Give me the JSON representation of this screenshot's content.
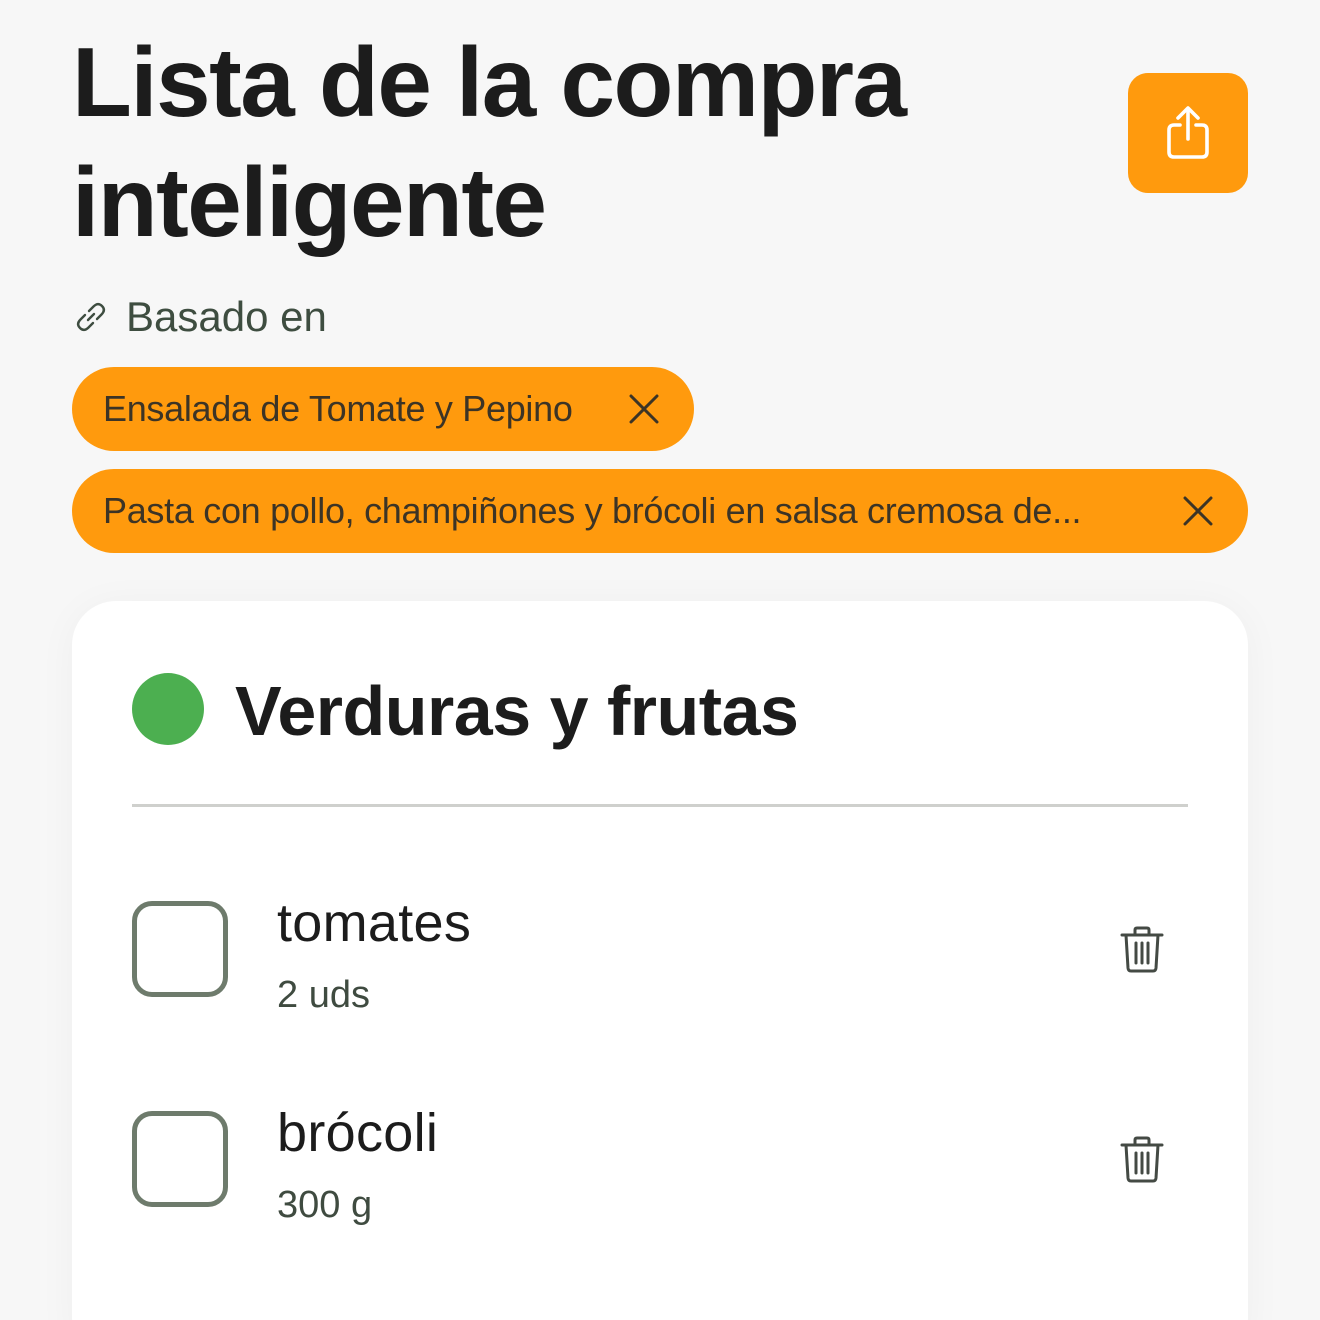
{
  "header": {
    "title": "Lista de la compra inteligente",
    "share_icon": "share-icon",
    "accent_color": "#ff9a0d"
  },
  "based_on": {
    "icon": "link-icon",
    "label": "Basado en",
    "recipes": [
      {
        "label": "Ensalada de Tomate y Pepino",
        "close_icon": "close-icon"
      },
      {
        "label": "Pasta con pollo, champiñones y brócoli en salsa cremosa de...",
        "close_icon": "close-icon"
      }
    ]
  },
  "category": {
    "title": "Verduras y frutas",
    "color": "#4caf50",
    "items": [
      {
        "name": "tomates",
        "quantity": "2 uds",
        "checked": false,
        "delete_icon": "trash-icon"
      },
      {
        "name": "brócoli",
        "quantity": "300 g",
        "checked": false,
        "delete_icon": "trash-icon"
      }
    ]
  }
}
